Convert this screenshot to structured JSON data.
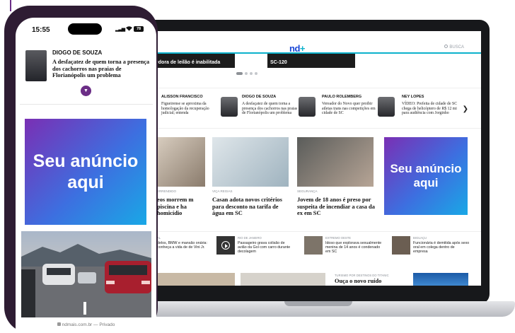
{
  "phone": {
    "status": {
      "time": "15:55",
      "battery": "78"
    },
    "columnist": {
      "name": "DIOGO DE SOUZA",
      "text": "A desfaçatez de quem torna a presença dos cachorros nas praias de Florianópolis um problema"
    },
    "ad_text": "Seu anúncio aqui",
    "url": "ndmais.com.br",
    "url_suffix": "— Privado"
  },
  "laptop": {
    "logo": "nd",
    "logo_plus": "+",
    "search_placeholder": "BUSCA",
    "hero": [
      {
        "caption": "eedora de leilão é inabilitada"
      },
      {
        "caption": "SC-120"
      }
    ],
    "columnists": [
      {
        "name": "ALISSON FRANCISCO",
        "text": "Figueirense se aproxima da homologação da recuperação judicial; entenda"
      },
      {
        "name": "DIOGO DE SOUZA",
        "text": "A desfaçatez de quem torna a presença dos cachorros nas praias de Florianópolis um problema"
      },
      {
        "name": "PAULO ROLEMBERG",
        "text": "Vereador do Novo quer proibir atletas trans nas competições em cidade de SC"
      },
      {
        "name": "NEY LOPES",
        "text": "VÍDEO: Prefeita de cidade de SC chega de helicóptero de R$ 12 mi para audiência com Jorginho"
      }
    ],
    "news": [
      {
        "category": "ERRENDIDO",
        "title": "eos morrem m piscina e ha homicídio"
      },
      {
        "category": "VIÇA REGIAS",
        "title": "Casan adota novos critérios para desconto na tarifa de água em SC"
      },
      {
        "category": "SEGURANÇA",
        "title": "Jovem de 18 anos é preso por suspeita de incendiar a casa da ex em SC"
      }
    ],
    "ad_text": "Seu anúncio aqui",
    "mini_news": [
      {
        "category": "AL",
        "title": "delos, BMW e mansão onária: conheça a vida de de Vini Jr."
      },
      {
        "category": "RIO DE JANEIRO",
        "title": "Passageiro grava colisão de avião da Gol com carro durante decolagem"
      },
      {
        "category": "EXTREMO OESTE",
        "title": "Idoso que explorava sexualmente menina de 14 anos é condenado em SC"
      },
      {
        "category": "BIGUAÇU",
        "title": "Funcionária é demitida após sexo oral em colega dentro de empresa"
      }
    ],
    "bottom": {
      "category": "TURISMO POR DESTINOS DO TITANIC",
      "title": "Ouça o novo ruído"
    }
  }
}
